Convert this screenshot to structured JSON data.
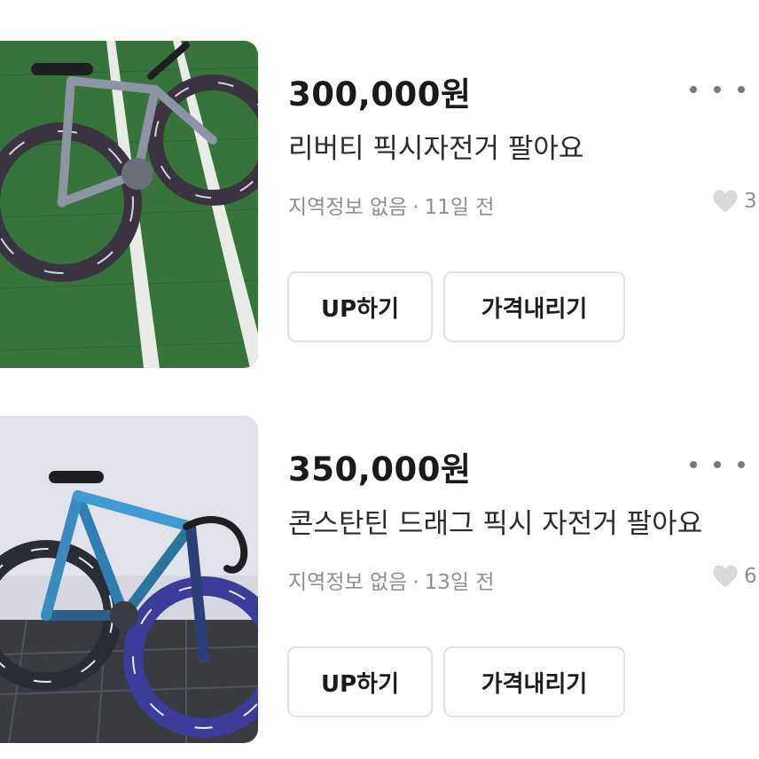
{
  "items": [
    {
      "price": "300,000원",
      "title": "리버티 픽시자전거 팔아요",
      "location": "지역정보 없음",
      "separator": "·",
      "time": "11일 전",
      "likes": "3",
      "up_label": "UP하기",
      "price_down_label": "가격내리기",
      "thumbnail_icon": "fixie-bike-photo"
    },
    {
      "price": "350,000원",
      "title": "콘스탄틴 드래그 픽시 자전거 팔아요",
      "location": "지역정보 없음",
      "separator": "·",
      "time": "13일 전",
      "likes": "6",
      "up_label": "UP하기",
      "price_down_label": "가격내리기",
      "thumbnail_icon": "fixie-bike-photo"
    }
  ],
  "colors": {
    "text_primary": "#1a1a1a",
    "text_secondary": "#8f8f8f",
    "button_border": "#e1e1e1",
    "heart": "#d9d9d9"
  }
}
